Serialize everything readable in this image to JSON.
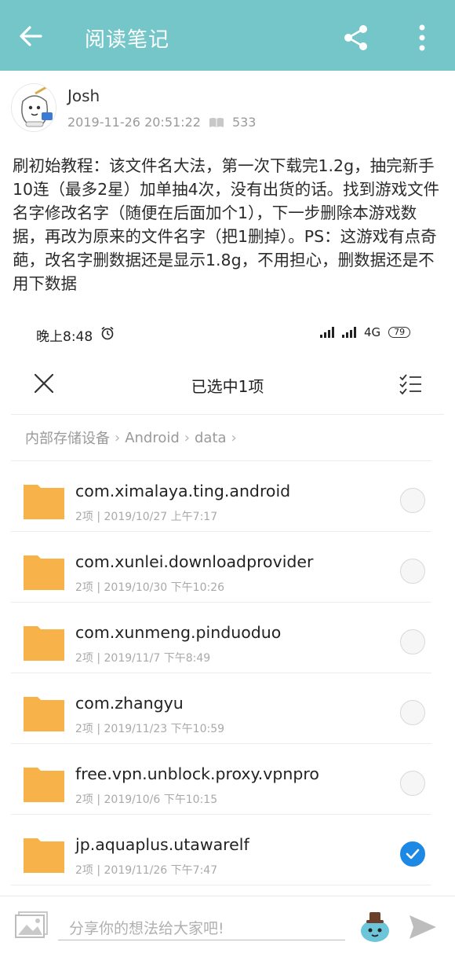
{
  "appbar": {
    "title": "阅读笔记"
  },
  "author": {
    "name": "Josh",
    "datetime": "2019-11-26 20:51:22",
    "views": "533"
  },
  "post": {
    "text": "刷初始教程：该文件名大法，第一次下载完1.2g，抽完新手10连（最多2星）加单抽4次，没有出货的话。找到游戏文件名字修改名字（随便在后面加个1），下一步删除本游戏数据，再改为原来的文件名字（把1删掉）。PS：这游戏有点奇葩，改名字删数据还是显示1.8g，不用担心，删数据还是不用下数据"
  },
  "screenshot": {
    "status": {
      "time": "晚上8:48",
      "network": "4G",
      "battery": "79"
    },
    "selection_title": "已选中1项",
    "breadcrumb": [
      "内部存储设备",
      "Android",
      "data"
    ],
    "files": [
      {
        "name": "com.ximalaya.ting.android",
        "meta": "2项 | 2019/10/27 上午7:17",
        "checked": false
      },
      {
        "name": "com.xunlei.downloadprovider",
        "meta": "2项 | 2019/10/30 下午10:26",
        "checked": false
      },
      {
        "name": "com.xunmeng.pinduoduo",
        "meta": "2项 | 2019/11/7 下午8:49",
        "checked": false
      },
      {
        "name": "com.zhangyu",
        "meta": "2项 | 2019/11/23 下午10:59",
        "checked": false
      },
      {
        "name": "free.vpn.unblock.proxy.vpnpro",
        "meta": "2项 | 2019/10/6 下午10:15",
        "checked": false
      },
      {
        "name": "jp.aquaplus.utawarelf",
        "meta": "2项 | 2019/11/26 下午7:47",
        "checked": true
      }
    ]
  },
  "composer": {
    "placeholder": "分享你的想法给大家吧!"
  },
  "colors": {
    "appbar": "#74c6c8",
    "folder": "#f7b24a",
    "check": "#1e88e5"
  }
}
